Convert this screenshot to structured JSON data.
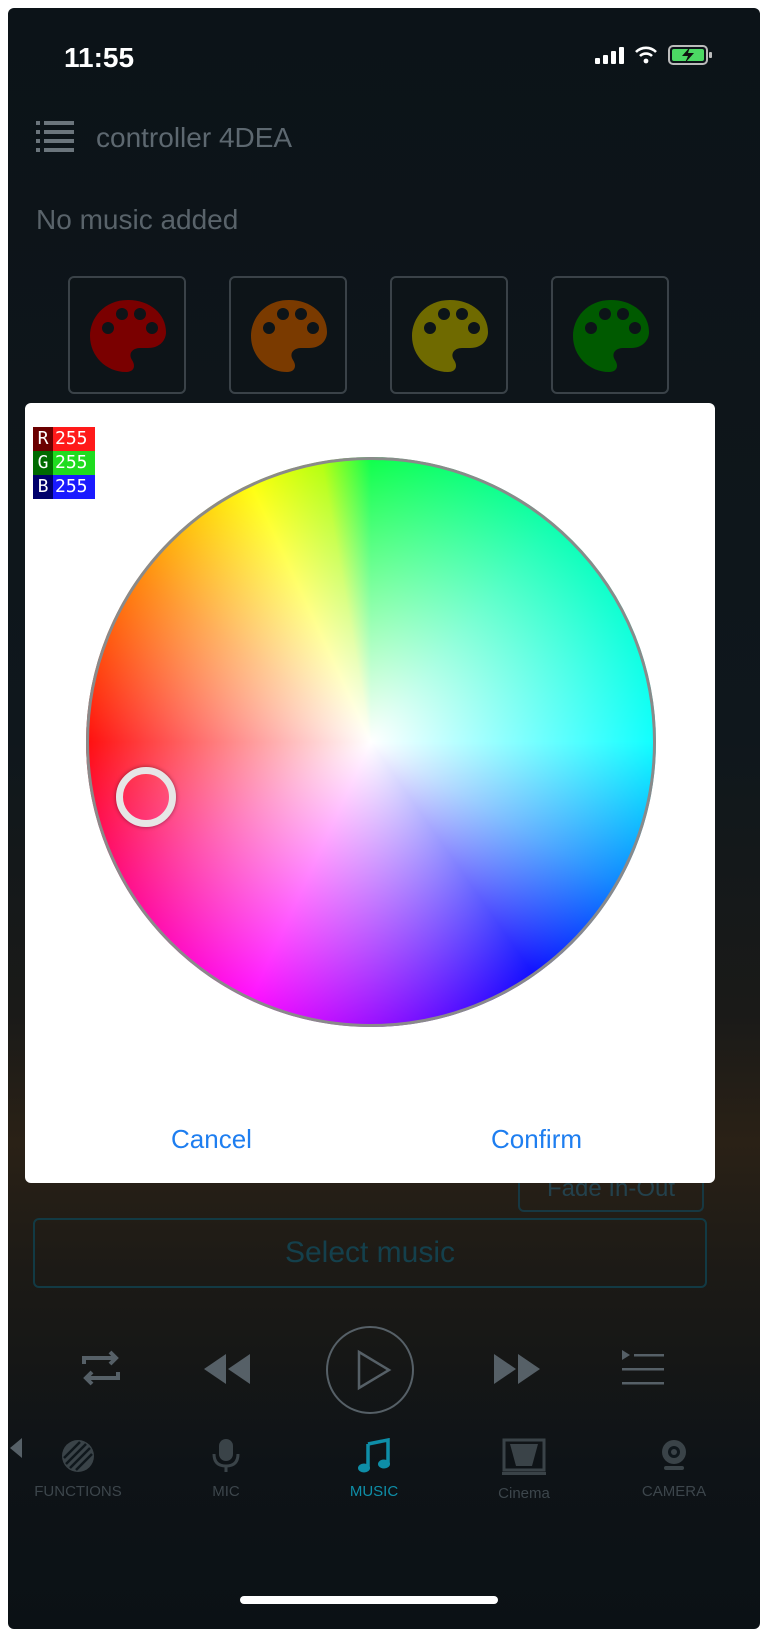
{
  "status_bar": {
    "time": "11:55"
  },
  "header": {
    "title": "controller 4DEA",
    "music_status": "No music added"
  },
  "presets": [
    {
      "name": "red-palette",
      "color": "#7a0000"
    },
    {
      "name": "orange-palette",
      "color": "#7a3a00"
    },
    {
      "name": "yellow-palette",
      "color": "#6f6a00"
    },
    {
      "name": "green-palette",
      "color": "#005a00"
    }
  ],
  "color_dialog": {
    "rgb": {
      "r_label": "R",
      "r_value": "255",
      "g_label": "G",
      "g_value": "255",
      "b_label": "B",
      "b_value": "255"
    },
    "cancel_label": "Cancel",
    "confirm_label": "Confirm"
  },
  "controls": {
    "fade_label": "Fade In-Out",
    "select_music_label": "Select music"
  },
  "tabs": [
    {
      "label": "FUNCTIONS",
      "icon": "functions-icon"
    },
    {
      "label": "MIC",
      "icon": "mic-icon"
    },
    {
      "label": "MUSIC",
      "icon": "music-note-icon",
      "active": true
    },
    {
      "label": "Cinema",
      "icon": "cinema-icon"
    },
    {
      "label": "CAMERA",
      "icon": "camera-icon"
    }
  ],
  "colors": {
    "accent": "#1e7ef0",
    "active_tab": "#0e8ea8"
  }
}
